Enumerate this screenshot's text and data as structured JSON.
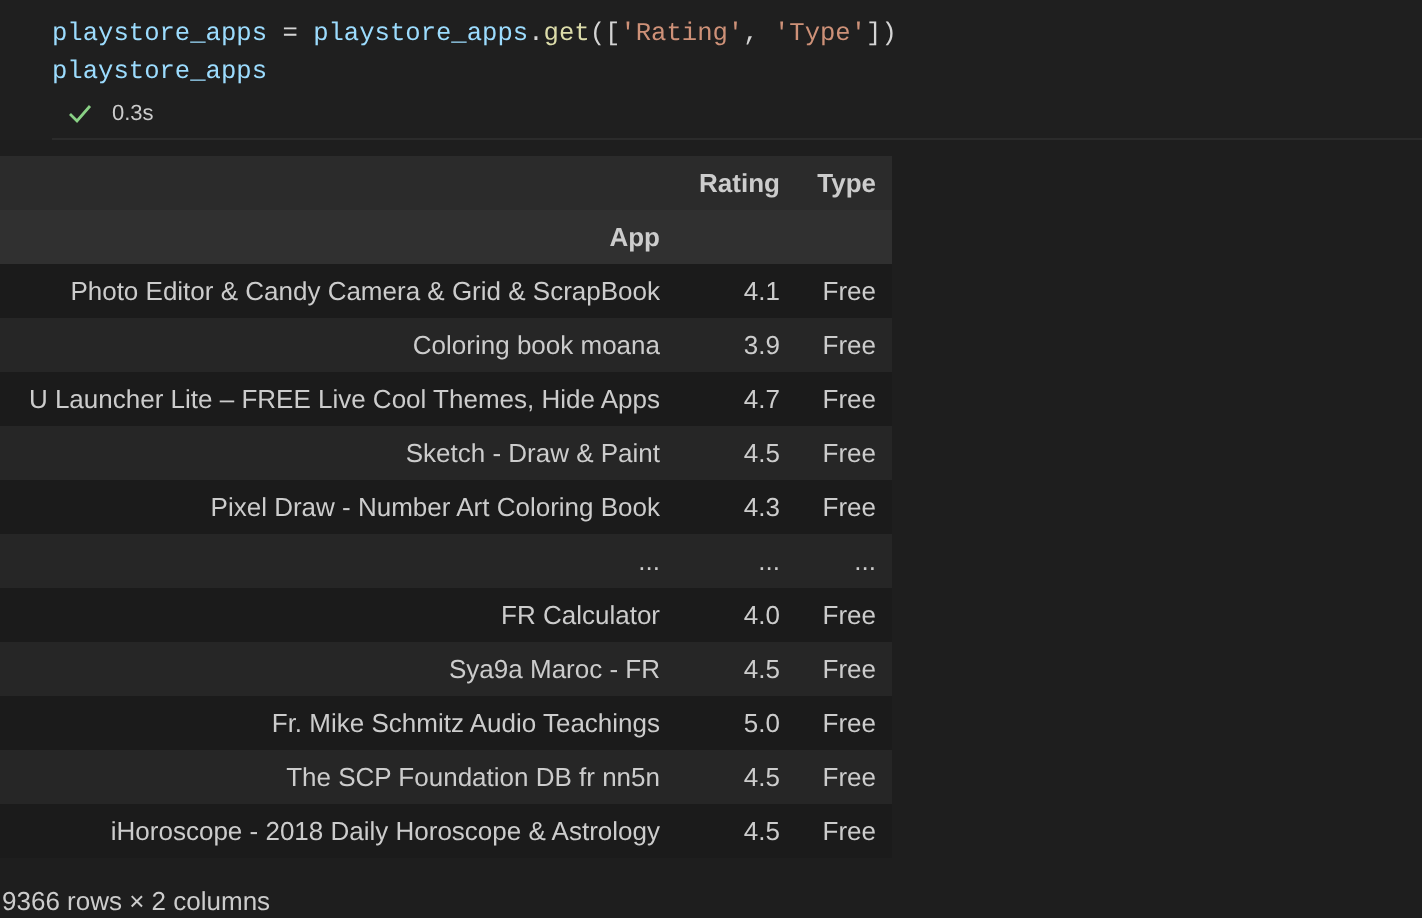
{
  "code_lines": [
    [
      {
        "kind": "var",
        "text": "playstore_apps"
      },
      {
        "kind": "op",
        "text": " = "
      },
      {
        "kind": "var",
        "text": "playstore_apps"
      },
      {
        "kind": "plain",
        "text": "."
      },
      {
        "kind": "func",
        "text": "get"
      },
      {
        "kind": "plain",
        "text": "(["
      },
      {
        "kind": "string",
        "text": "'Rating'"
      },
      {
        "kind": "plain",
        "text": ", "
      },
      {
        "kind": "string",
        "text": "'Type'"
      },
      {
        "kind": "plain",
        "text": "])"
      }
    ],
    [
      {
        "kind": "var",
        "text": "playstore_apps"
      }
    ]
  ],
  "execution": {
    "success": true,
    "time": "0.3s"
  },
  "table": {
    "columns": [
      "Rating",
      "Type"
    ],
    "index_name": "App",
    "rows": [
      {
        "app": "Photo Editor & Candy Camera & Grid & ScrapBook",
        "rating": "4.1",
        "type": "Free"
      },
      {
        "app": "Coloring book moana",
        "rating": "3.9",
        "type": "Free"
      },
      {
        "app": "U Launcher Lite – FREE Live Cool Themes, Hide Apps",
        "rating": "4.7",
        "type": "Free"
      },
      {
        "app": "Sketch - Draw & Paint",
        "rating": "4.5",
        "type": "Free"
      },
      {
        "app": "Pixel Draw - Number Art Coloring Book",
        "rating": "4.3",
        "type": "Free"
      },
      {
        "app": "...",
        "rating": "...",
        "type": "..."
      },
      {
        "app": "FR Calculator",
        "rating": "4.0",
        "type": "Free"
      },
      {
        "app": "Sya9a Maroc - FR",
        "rating": "4.5",
        "type": "Free"
      },
      {
        "app": "Fr. Mike Schmitz Audio Teachings",
        "rating": "5.0",
        "type": "Free"
      },
      {
        "app": "The SCP Foundation DB fr nn5n",
        "rating": "4.5",
        "type": "Free"
      },
      {
        "app": "iHoroscope - 2018 Daily Horoscope & Astrology",
        "rating": "4.5",
        "type": "Free"
      }
    ],
    "shape": "9366 rows × 2 columns"
  }
}
